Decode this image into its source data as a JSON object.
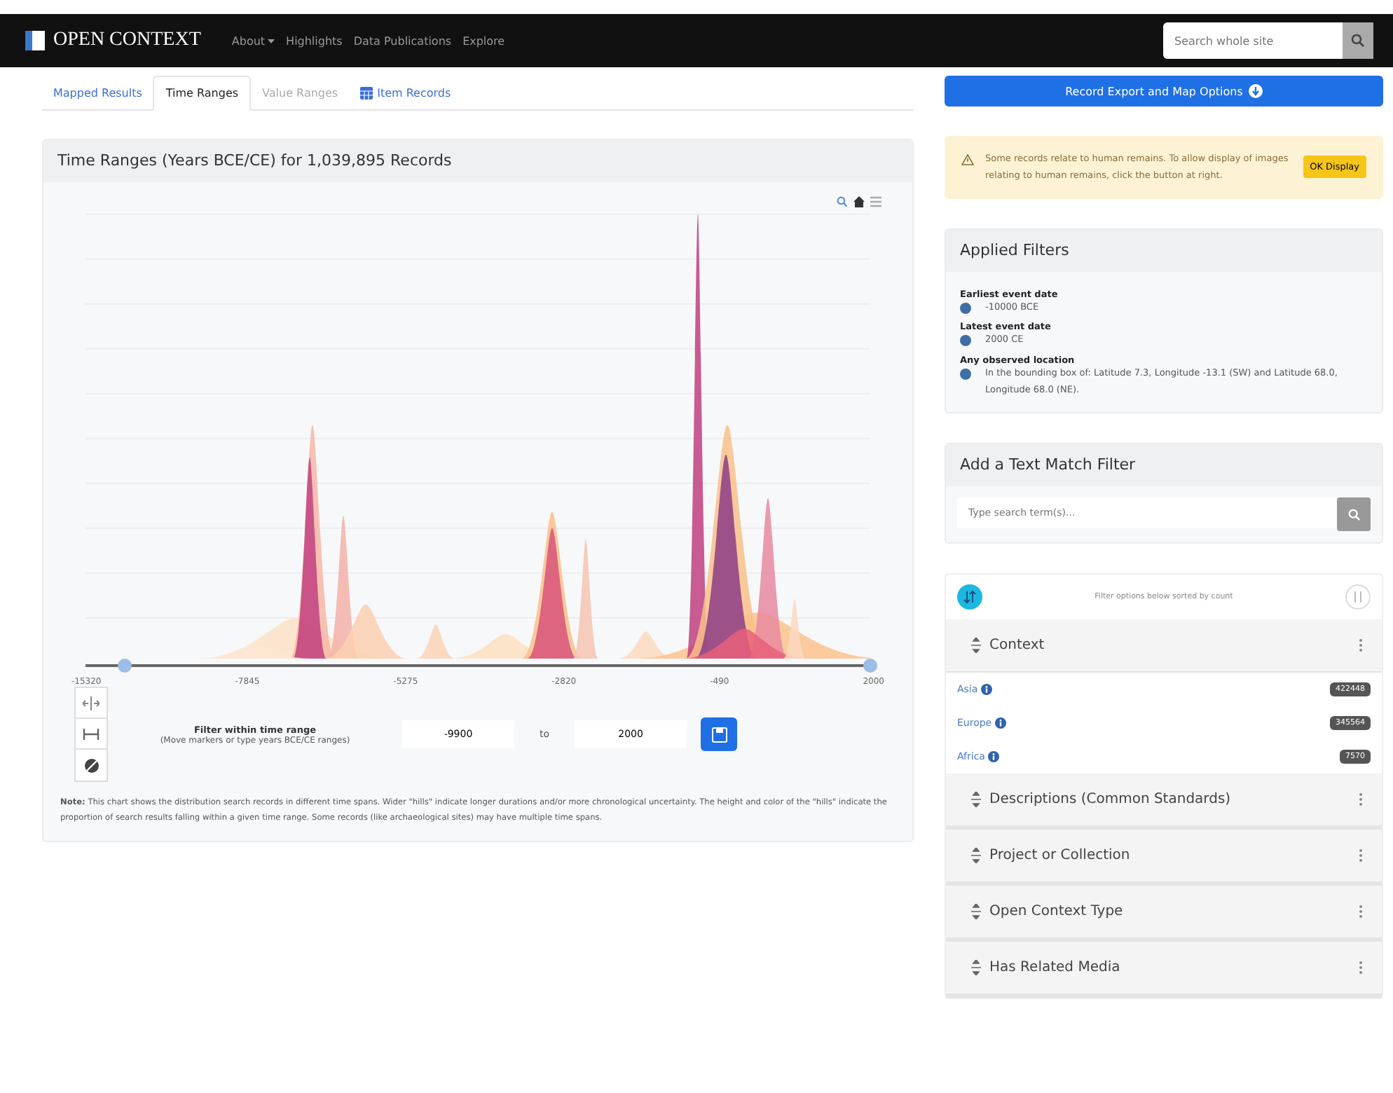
{
  "navbar": {
    "brand": "OPEN CONTEXT",
    "menu": [
      {
        "label": "About",
        "dropdown": true
      },
      {
        "label": "Highlights",
        "dropdown": false
      },
      {
        "label": "Data Publications",
        "dropdown": false
      },
      {
        "label": "Explore",
        "dropdown": false
      }
    ],
    "search": {
      "placeholder": "Search whole site"
    }
  },
  "tabs": [
    {
      "label": "Mapped Results",
      "selected": false,
      "disabled": false,
      "kind": "text"
    },
    {
      "label": "Time Ranges",
      "selected": true,
      "disabled": false,
      "kind": "text"
    },
    {
      "label": "Value Ranges",
      "selected": false,
      "disabled": true,
      "kind": "text"
    },
    {
      "label": "Item Records",
      "selected": false,
      "disabled": false,
      "kind": "table"
    }
  ],
  "chart_panel": {
    "title": "Time Ranges (Years BCE/CE) for 1,039,895 Records",
    "axis_labels": [
      "-15320",
      "-7845",
      "-5275",
      "-2820",
      "-490",
      "2000"
    ],
    "range_handles": [
      {
        "level": 0.05
      },
      {
        "level": 1
      }
    ],
    "filter": {
      "title": "Filter within time range",
      "hint": "(Move markers or type years BCE/CE ranges)",
      "start": "-9900",
      "joiner": "to",
      "end": "2000"
    },
    "note": "**Note:** This chart shows the distribution search records in different time spans. Wider \"hills\" indicate longer durations and/or more chronological uncertainty. The height and color of the \"hills\" indicate the proportion of search results falling within a given time range. Some records (like archaeological sites) may have multiple time spans."
  },
  "export_button": "Record Export and Map Options",
  "warning": {
    "text": "Some records relate to human remains. To allow display of images relating to human remains, click the button at right.",
    "button": "OK Display"
  },
  "applied_filters": {
    "title": "Applied Filters",
    "filters": [
      {
        "label": "Earliest event date",
        "value": "-10000 BCE"
      },
      {
        "label": "Latest event date",
        "value": "2000 CE"
      },
      {
        "label": "Any observed location",
        "value": "In the bounding box of: Latitude 7.3, Longitude -13.1 (SW) and Latitude 68.0, Longitude 68.0 (NE)."
      }
    ]
  },
  "text_filter": {
    "title": "Add a Text Match Filter",
    "placeholder": "Type search term(s)..."
  },
  "facet_sort": {
    "note": "Filter options below sorted by count"
  },
  "facets": [
    {
      "label": "Context",
      "expanded": true,
      "options": [
        {
          "label": "Asia",
          "count": "422448"
        },
        {
          "label": "Europe",
          "count": "345564"
        },
        {
          "label": "Africa",
          "count": "7570"
        }
      ]
    },
    {
      "label": "Descriptions (Common Standards)",
      "expanded": false
    },
    {
      "label": "Project or Collection",
      "expanded": false
    },
    {
      "label": "Open Context Type",
      "expanded": false
    },
    {
      "label": "Has Related Media",
      "expanded": false
    }
  ]
}
